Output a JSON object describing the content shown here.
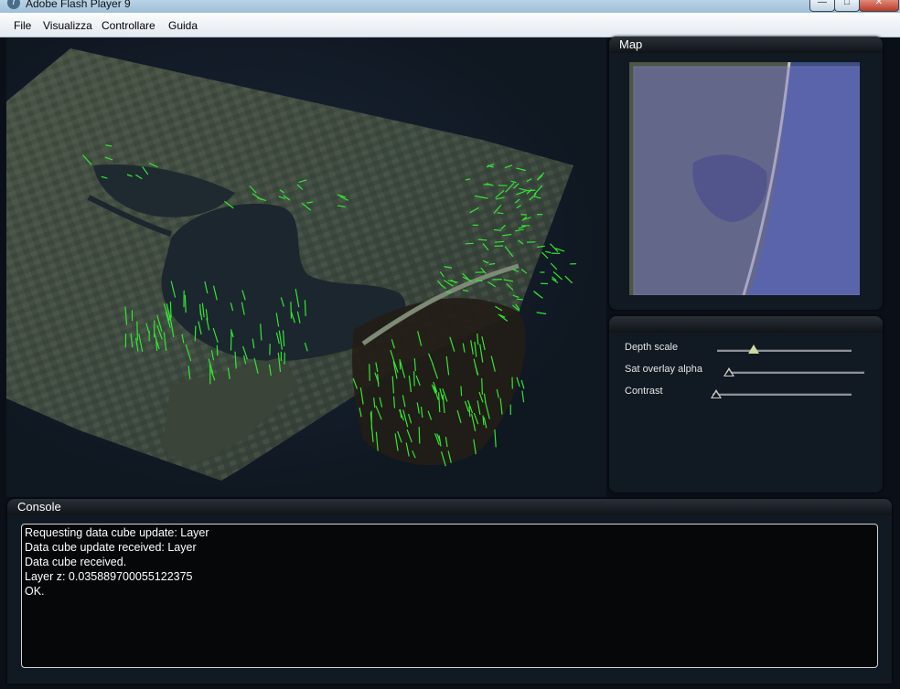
{
  "window": {
    "title": "Adobe Flash Player 9",
    "icon": "flash-player-icon"
  },
  "menu": {
    "items": [
      "File",
      "Visualizza",
      "Controllare",
      "Guida"
    ]
  },
  "map_panel": {
    "title": "Map"
  },
  "controls_panel": {
    "sliders": [
      {
        "label": "Depth scale",
        "value_fraction": 0.27
      },
      {
        "label": "Sat overlay alpha",
        "value_fraction": 0.0
      },
      {
        "label": "Contrast",
        "value_fraction": 0.0
      }
    ]
  },
  "console": {
    "title": "Console",
    "lines": [
      "Requesting data cube update: Layer",
      "Data cube update received: Layer",
      "Data cube received.",
      "Layer z: 0.035889700055122375",
      "OK."
    ]
  },
  "colors": {
    "vector_color": "#33e633",
    "overlay_color": "#7f7fe0",
    "panel_bg": "#111922"
  }
}
